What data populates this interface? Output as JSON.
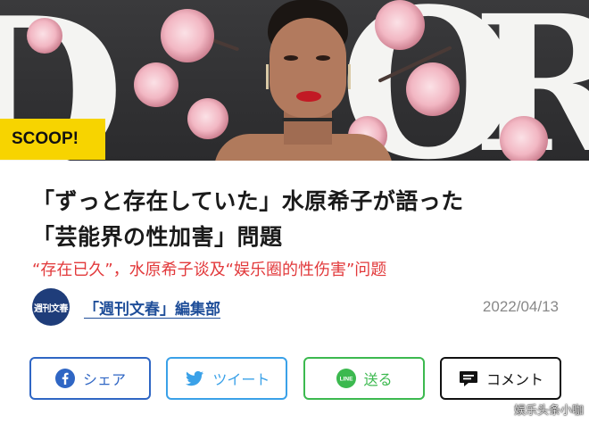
{
  "hero": {
    "badge": "SCOOP!",
    "backdrop_letters": [
      "D",
      "O",
      "R"
    ]
  },
  "article": {
    "title_line1": "「ずっと存在していた」水原希子が語った",
    "title_line2": "「芸能界の性加害」問題",
    "subtitle": "“存在已久”，水原希子谈及“娱乐圈的性伤害”问题"
  },
  "byline": {
    "avatar_text": "週刊文春",
    "author": "「週刊文春」編集部",
    "date": "2022/04/13"
  },
  "share": {
    "facebook_label": "シェア",
    "twitter_label": "ツイート",
    "line_label": "送る",
    "line_icon_text": "LINE",
    "comment_label": "コメント"
  },
  "watermark": "娱乐头条小咖",
  "colors": {
    "badge": "#f7d400",
    "subtitle": "#e2393b",
    "author": "#1f4e99",
    "facebook": "#2f66c4",
    "twitter": "#3aa1e8",
    "line": "#3cb94f"
  }
}
